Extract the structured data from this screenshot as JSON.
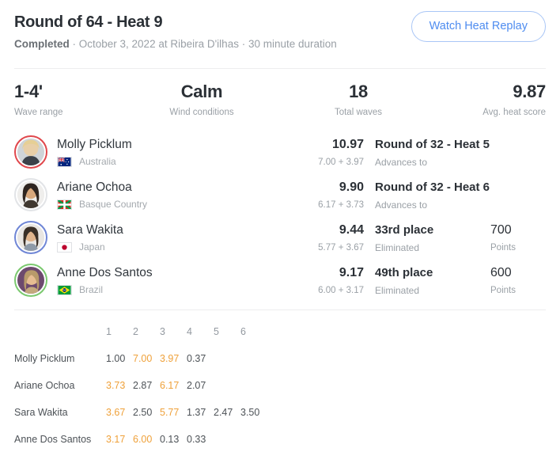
{
  "header": {
    "title": "Round of 64 - Heat 9",
    "status": "Completed",
    "meta": " · October 3, 2022 at Ribeira D'ilhas · 30 minute duration",
    "replay_button": "Watch Heat Replay"
  },
  "stats": [
    {
      "value": "1-4'",
      "label": "Wave range"
    },
    {
      "value": "Calm",
      "label": "Wind conditions"
    },
    {
      "value": "18",
      "label": "Total waves"
    },
    {
      "value": "9.87",
      "label": "Avg. heat score"
    }
  ],
  "athletes": [
    {
      "name": "Molly Picklum",
      "country": "Australia",
      "flag": "australia-flag",
      "ring_color": "#e0474c",
      "total": "10.97",
      "parts": "7.00 + 3.97",
      "status_main": "Round of 32 - Heat 5",
      "status_sub": "Advances to",
      "points": "",
      "points_label": ""
    },
    {
      "name": "Ariane Ochoa",
      "country": "Basque Country",
      "flag": "basque-flag",
      "ring_color": "#e2e4e7",
      "total": "9.90",
      "parts": "6.17 + 3.73",
      "status_main": "Round of 32 - Heat 6",
      "status_sub": "Advances to",
      "points": "",
      "points_label": ""
    },
    {
      "name": "Sara Wakita",
      "country": "Japan",
      "flag": "japan-flag",
      "ring_color": "#6f86d6",
      "total": "9.44",
      "parts": "5.77 + 3.67",
      "status_main": "33rd place",
      "status_sub": "Eliminated",
      "points": "700",
      "points_label": "Points"
    },
    {
      "name": "Anne Dos Santos",
      "country": "Brazil",
      "flag": "brazil-flag",
      "ring_color": "#7bc96f",
      "total": "9.17",
      "parts": "6.00 + 3.17",
      "status_main": "49th place",
      "status_sub": "Eliminated",
      "points": "600",
      "points_label": "Points"
    }
  ],
  "waves": {
    "columns": [
      "1",
      "2",
      "3",
      "4",
      "5",
      "6"
    ],
    "rows": [
      {
        "name": "Molly Picklum",
        "scores": [
          "1.00",
          "7.00",
          "3.97",
          "0.37",
          "",
          ""
        ],
        "counted": [
          false,
          true,
          true,
          false,
          false,
          false
        ]
      },
      {
        "name": "Ariane Ochoa",
        "scores": [
          "3.73",
          "2.87",
          "6.17",
          "2.07",
          "",
          ""
        ],
        "counted": [
          true,
          false,
          true,
          false,
          false,
          false
        ]
      },
      {
        "name": "Sara Wakita",
        "scores": [
          "3.67",
          "2.50",
          "5.77",
          "1.37",
          "2.47",
          "3.50"
        ],
        "counted": [
          true,
          false,
          true,
          false,
          false,
          false
        ]
      },
      {
        "name": "Anne Dos Santos",
        "scores": [
          "3.17",
          "6.00",
          "0.13",
          "0.33",
          "",
          ""
        ],
        "counted": [
          true,
          true,
          false,
          false,
          false,
          false
        ]
      }
    ]
  },
  "colors": {
    "accent_blue": "#4e8cf0",
    "counted_orange": "#efa13a",
    "text_primary": "#2b3036",
    "text_muted": "#9aa0a6"
  }
}
